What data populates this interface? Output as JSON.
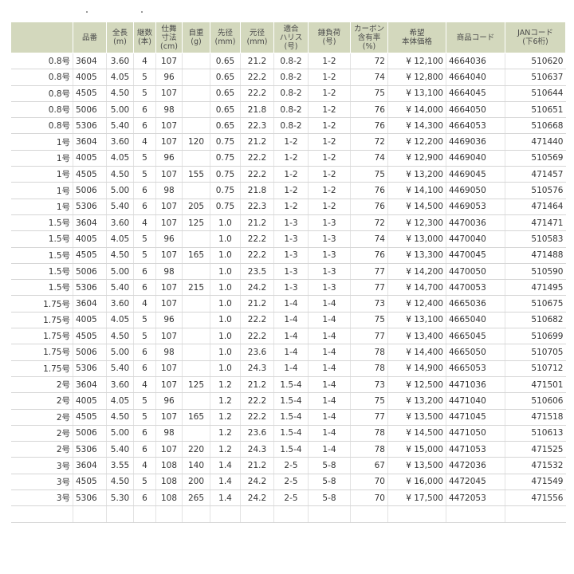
{
  "header": {
    "cols": [
      "",
      "品番",
      "全長\n(m)",
      "継数\n(本)",
      "仕舞\n寸法\n(cm)",
      "自重\n(g)",
      "先径\n(mm)",
      "元径\n(mm)",
      "適合\nハリス\n(号)",
      "錘負荷\n(号)",
      "カーボン\n含有率\n(%)",
      "希望\n本体価格",
      "商品コード",
      "JANコード\n(下6桁)"
    ]
  },
  "rows": [
    [
      "0.8号",
      "3604",
      "3.60",
      "4",
      "107",
      "",
      "0.65",
      "21.2",
      "0.8-2",
      "1-2",
      "72",
      "¥ 12,100",
      "4664036",
      "510620"
    ],
    [
      "0.8号",
      "4005",
      "4.05",
      "5",
      "96",
      "",
      "0.65",
      "22.2",
      "0.8-2",
      "1-2",
      "74",
      "¥ 12,800",
      "4664040",
      "510637"
    ],
    [
      "0.8号",
      "4505",
      "4.50",
      "5",
      "107",
      "",
      "0.65",
      "22.2",
      "0.8-2",
      "1-2",
      "75",
      "¥ 13,100",
      "4664045",
      "510644"
    ],
    [
      "0.8号",
      "5006",
      "5.00",
      "6",
      "98",
      "",
      "0.65",
      "21.8",
      "0.8-2",
      "1-2",
      "76",
      "¥ 14,000",
      "4664050",
      "510651"
    ],
    [
      "0.8号",
      "5306",
      "5.40",
      "6",
      "107",
      "",
      "0.65",
      "22.3",
      "0.8-2",
      "1-2",
      "76",
      "¥ 14,300",
      "4664053",
      "510668"
    ],
    [
      "1号",
      "3604",
      "3.60",
      "4",
      "107",
      "120",
      "0.75",
      "21.2",
      "1-2",
      "1-2",
      "72",
      "¥ 12,200",
      "4469036",
      "471440"
    ],
    [
      "1号",
      "4005",
      "4.05",
      "5",
      "96",
      "",
      "0.75",
      "22.2",
      "1-2",
      "1-2",
      "74",
      "¥ 12,900",
      "4469040",
      "510569"
    ],
    [
      "1号",
      "4505",
      "4.50",
      "5",
      "107",
      "155",
      "0.75",
      "22.2",
      "1-2",
      "1-2",
      "75",
      "¥ 13,200",
      "4469045",
      "471457"
    ],
    [
      "1号",
      "5006",
      "5.00",
      "6",
      "98",
      "",
      "0.75",
      "21.8",
      "1-2",
      "1-2",
      "76",
      "¥ 14,100",
      "4469050",
      "510576"
    ],
    [
      "1号",
      "5306",
      "5.40",
      "6",
      "107",
      "205",
      "0.75",
      "22.3",
      "1-2",
      "1-2",
      "76",
      "¥ 14,500",
      "4469053",
      "471464"
    ],
    [
      "1.5号",
      "3604",
      "3.60",
      "4",
      "107",
      "125",
      "1.0",
      "21.2",
      "1-3",
      "1-3",
      "72",
      "¥ 12,300",
      "4470036",
      "471471"
    ],
    [
      "1.5号",
      "4005",
      "4.05",
      "5",
      "96",
      "",
      "1.0",
      "22.2",
      "1-3",
      "1-3",
      "74",
      "¥ 13,000",
      "4470040",
      "510583"
    ],
    [
      "1.5号",
      "4505",
      "4.50",
      "5",
      "107",
      "165",
      "1.0",
      "22.2",
      "1-3",
      "1-3",
      "76",
      "¥ 13,300",
      "4470045",
      "471488"
    ],
    [
      "1.5号",
      "5006",
      "5.00",
      "6",
      "98",
      "",
      "1.0",
      "23.5",
      "1-3",
      "1-3",
      "77",
      "¥ 14,200",
      "4470050",
      "510590"
    ],
    [
      "1.5号",
      "5306",
      "5.40",
      "6",
      "107",
      "215",
      "1.0",
      "24.2",
      "1-3",
      "1-3",
      "77",
      "¥ 14,700",
      "4470053",
      "471495"
    ],
    [
      "1.75号",
      "3604",
      "3.60",
      "4",
      "107",
      "",
      "1.0",
      "21.2",
      "1-4",
      "1-4",
      "73",
      "¥ 12,400",
      "4665036",
      "510675"
    ],
    [
      "1.75号",
      "4005",
      "4.05",
      "5",
      "96",
      "",
      "1.0",
      "22.2",
      "1-4",
      "1-4",
      "75",
      "¥ 13,100",
      "4665040",
      "510682"
    ],
    [
      "1.75号",
      "4505",
      "4.50",
      "5",
      "107",
      "",
      "1.0",
      "22.2",
      "1-4",
      "1-4",
      "77",
      "¥ 13,400",
      "4665045",
      "510699"
    ],
    [
      "1.75号",
      "5006",
      "5.00",
      "6",
      "98",
      "",
      "1.0",
      "23.6",
      "1-4",
      "1-4",
      "78",
      "¥ 14,400",
      "4665050",
      "510705"
    ],
    [
      "1.75号",
      "5306",
      "5.40",
      "6",
      "107",
      "",
      "1.0",
      "24.3",
      "1-4",
      "1-4",
      "78",
      "¥ 14,900",
      "4665053",
      "510712"
    ],
    [
      "2号",
      "3604",
      "3.60",
      "4",
      "107",
      "125",
      "1.2",
      "21.2",
      "1.5-4",
      "1-4",
      "73",
      "¥ 12,500",
      "4471036",
      "471501"
    ],
    [
      "2号",
      "4005",
      "4.05",
      "5",
      "96",
      "",
      "1.2",
      "22.2",
      "1.5-4",
      "1-4",
      "75",
      "¥ 13,200",
      "4471040",
      "510606"
    ],
    [
      "2号",
      "4505",
      "4.50",
      "5",
      "107",
      "165",
      "1.2",
      "22.2",
      "1.5-4",
      "1-4",
      "77",
      "¥ 13,500",
      "4471045",
      "471518"
    ],
    [
      "2号",
      "5006",
      "5.00",
      "6",
      "98",
      "",
      "1.2",
      "23.6",
      "1.5-4",
      "1-4",
      "78",
      "¥ 14,500",
      "4471050",
      "510613"
    ],
    [
      "2号",
      "5306",
      "5.40",
      "6",
      "107",
      "220",
      "1.2",
      "24.3",
      "1.5-4",
      "1-4",
      "78",
      "¥ 15,000",
      "4471053",
      "471525"
    ],
    [
      "3号",
      "3604",
      "3.55",
      "4",
      "108",
      "140",
      "1.4",
      "21.2",
      "2-5",
      "5-8",
      "67",
      "¥ 13,500",
      "4472036",
      "471532"
    ],
    [
      "3号",
      "4505",
      "4.50",
      "5",
      "108",
      "200",
      "1.4",
      "24.2",
      "2-5",
      "5-8",
      "70",
      "¥ 16,000",
      "4472045",
      "471549"
    ],
    [
      "3号",
      "5306",
      "5.30",
      "6",
      "108",
      "265",
      "1.4",
      "24.2",
      "2-5",
      "5-8",
      "70",
      "¥ 17,500",
      "4472053",
      "471556"
    ]
  ]
}
